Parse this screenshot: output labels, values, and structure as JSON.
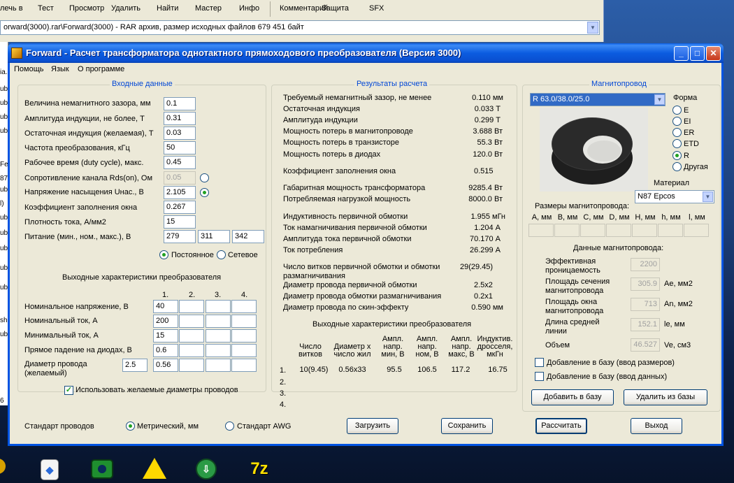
{
  "bg_toolbar": [
    "лечь в",
    "Тест",
    "Просмотр",
    "Удалить",
    "Найти",
    "Мастер",
    "Инфо",
    "Комментарий",
    "Защита",
    "SFX"
  ],
  "bg_address": "orward(3000).rar\\Forward(3000) - RAR архив, размер исходных файлов 679 451 байт",
  "left_strip": [
    "ia.",
    "ub",
    "ub",
    "ub",
    "ub",
    "Fe",
    "87",
    "ub",
    "l)",
    "ub",
    "ub",
    "ub",
    "ub",
    "ub",
    "sh",
    "ub",
    "6"
  ],
  "window": {
    "title": "Forward - Расчет трансформатора однотактного прямоходового преобразователя (Версия 3000)",
    "menu": [
      "Помощь",
      "Язык",
      "О программе"
    ],
    "buttons": {
      "min": "_",
      "max": "□",
      "close": "✕"
    }
  },
  "input": {
    "title": "Входные данные",
    "rows": [
      {
        "label": "Величина немагнитного зазора, мм",
        "value": "0.1"
      },
      {
        "label": "Амплитуда индукции, не более, Т",
        "value": "0.31"
      },
      {
        "label": "Остаточная индукция (желаемая), Т",
        "value": "0.03"
      },
      {
        "label": "Частота преобразования, кГц",
        "value": "50"
      },
      {
        "label": "Рабочее время (duty cycle), макс.",
        "value": "0.45"
      },
      {
        "label": "Сопротивление канала Rds(on), Ом",
        "value": "0.05"
      },
      {
        "label": "Напряжение насыщения Uнас., В",
        "value": "2.105"
      },
      {
        "label": "Коэффициент заполнения окна",
        "value": "0.267"
      },
      {
        "label": "Плотность тока, А/мм2",
        "value": "15"
      }
    ],
    "supply_label": "Питание (мин., ном., макс.), В",
    "supply": [
      "279",
      "311",
      "342"
    ],
    "dc_label": "Постоянное",
    "ac_label": "Сетевое"
  },
  "out_char": {
    "title": "Выходные характеристики преобразователя",
    "cols": [
      "1.",
      "2.",
      "3.",
      "4."
    ],
    "rows": [
      {
        "label": "Номинальное напряжение, В",
        "values": [
          "40",
          "",
          "",
          ""
        ]
      },
      {
        "label": "Номинальный ток, А",
        "values": [
          "200",
          "",
          "",
          ""
        ]
      },
      {
        "label": "Минимальный ток, А",
        "values": [
          "15",
          "",
          "",
          ""
        ]
      },
      {
        "label": "Прямое падение на диодах, В",
        "values": [
          "0.6",
          "",
          "",
          ""
        ]
      }
    ],
    "wire_label": "Диаметр провода\n(желаемый)",
    "wire_extra": "2.5",
    "wire_values": [
      "0.56",
      "",
      "",
      ""
    ],
    "use_desired": "Использовать желаемые диаметры проводов"
  },
  "results": {
    "title": "Результаты расчета",
    "rows": [
      {
        "label": "Требуемый немагнитный зазор, не менее",
        "value": "0.110 мм"
      },
      {
        "label": "Остаточная индукция",
        "value": "0.033 Т"
      },
      {
        "label": "Амплитуда индукции",
        "value": "0.299 Т"
      },
      {
        "label": "Мощность потерь в магнитопроводе",
        "value": "3.688 Вт"
      },
      {
        "label": "Мощность потерь в транзисторе",
        "value": "55.3 Вт"
      },
      {
        "label": "Мощность потерь в диодах",
        "value": "120.0 Вт"
      },
      {
        "label": "Коэффициент заполнения окна",
        "value": "0.515"
      },
      {
        "label": "Габаритная мощность трансформатора",
        "value": "9285.4 Вт"
      },
      {
        "label": "Потребляемая нагрузкой мощность",
        "value": "8000.0 Вт"
      },
      {
        "label": "Индуктивность первичной обмотки",
        "value": "1.955 мГн"
      },
      {
        "label": "Ток намагничивания первичной обмотки",
        "value": "1.204 А"
      },
      {
        "label": "Амплитуда тока первичной обмотки",
        "value": "70.170 А"
      },
      {
        "label": "Ток потребления",
        "value": "26.299 А"
      },
      {
        "label": "Число витков первичной обмотки и обмотки\nразмагничивания",
        "value": "29(29.45)"
      },
      {
        "label": "Диаметр провода первичной обмотки",
        "value": "2.5x2"
      },
      {
        "label": "Диаметр провода обмотки размагничивания",
        "value": "0.2x1"
      },
      {
        "label": "Диаметр провода по скин-эффекту",
        "value": "0.590 мм"
      }
    ],
    "out_title": "Выходные характеристики преобразователя",
    "out_headers": [
      "Число\nвитков",
      "Диаметр х\nчисло жил",
      "Ампл.\nнапр.\nмин, В",
      "Ампл.\nнапр.\nном, В",
      "Ампл.\nнапр.\nмакс, В",
      "Индуктив.\nдросселя,\nмкГн"
    ],
    "out_rows": [
      {
        "n": "1.",
        "values": [
          "10(9.45)",
          "0.56x33",
          "95.5",
          "106.5",
          "117.2",
          "16.75"
        ]
      },
      {
        "n": "2.",
        "values": [
          "",
          "",
          "",
          "",
          "",
          ""
        ]
      },
      {
        "n": "3.",
        "values": [
          "",
          "",
          "",
          "",
          "",
          ""
        ]
      },
      {
        "n": "4.",
        "values": [
          "",
          "",
          "",
          "",
          "",
          ""
        ]
      }
    ]
  },
  "core": {
    "title": "Магнитопровод",
    "selected": "R 63.0/38.0/25.0",
    "shape_label": "Форма",
    "shapes": [
      "E",
      "EI",
      "ER",
      "ETD",
      "R",
      "Другая"
    ],
    "selected_shape": "R",
    "material_label": "Материал",
    "material": "N87 Epcos",
    "dims_label": "Размеры магнитопровода:",
    "dims": [
      "A, мм",
      "B, мм",
      "C, мм",
      "D, мм",
      "H, мм",
      "h, мм",
      "l, мм"
    ],
    "data_label": "Данные магнитопровода:",
    "params": [
      {
        "label": "Эффективная\nпроницаемость",
        "value": "2200",
        "unit": ""
      },
      {
        "label": "Площадь сечения\nмагнитопровода",
        "value": "305.9",
        "unit": "Ae, мм2"
      },
      {
        "label": "Площадь окна\nмагнитопровода",
        "value": "713",
        "unit": "An, мм2"
      },
      {
        "label": "Длина средней\nлинии",
        "value": "152.1",
        "unit": "le, мм"
      },
      {
        "label": "Объем",
        "value": "46.527",
        "unit": "Ve, см3"
      }
    ],
    "add_dims": "Добавление в базу (ввод размеров)",
    "add_data": "Добавление в базу (ввод данных)",
    "btn_add": "Добавить в базу",
    "btn_del": "Удалить из базы"
  },
  "bottom": {
    "std_label": "Стандарт проводов",
    "metric": "Метрический, мм",
    "awg": "Стандарт AWG",
    "load": "Загрузить",
    "save": "Сохранить",
    "calc": "Рассчитать",
    "exit": "Выход"
  },
  "taskbar_icons": [
    "search-icon",
    "app-icon",
    "camera-icon",
    "warning-icon",
    "download-icon",
    "sevenzip-icon"
  ]
}
